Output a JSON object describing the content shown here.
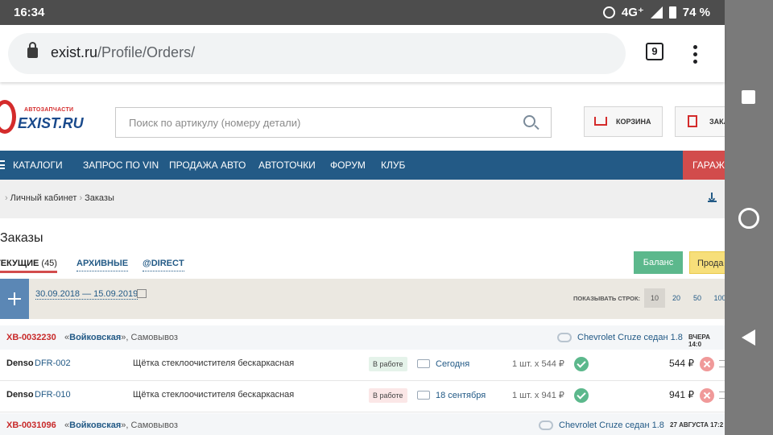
{
  "statusbar": {
    "time": "16:34",
    "network": "4G⁺",
    "battery": "74 %"
  },
  "browser": {
    "url_host": "exist.ru",
    "url_path": "/Profile/Orders/",
    "tab_count": "9"
  },
  "header": {
    "logo_small": "АВТОЗАПЧАСТИ",
    "logo_big": "EXIST.RU",
    "search_placeholder": "Поиск по артикулу (номеру детали)",
    "cart_label": "КОРЗИНА",
    "orders_label": "ЗАКА"
  },
  "menu": {
    "items": [
      "КАТАЛОГИ",
      "ЗАПРОС ПО VIN",
      "ПРОДАЖА АВТО",
      "АВТОТОЧКИ",
      "ФОРУМ",
      "КЛУБ"
    ],
    "garage": "ГАРАЖ"
  },
  "breadcrumbs": {
    "cabinet": "Личный кабинет",
    "current": "Заказы"
  },
  "page": {
    "title": "Заказы"
  },
  "tabs": {
    "current_label": "ТЕКУЩИЕ",
    "current_count": "(45)",
    "archive_label": "АРХИВНЫЕ",
    "direct_label": "@DIRECT"
  },
  "actions": {
    "balance": "Баланс",
    "prod": "Прода"
  },
  "filter": {
    "date_range": "30.09.2018 — 15.09.2019",
    "rows_label": "ПОКАЗЫВАТЬ СТРОК:",
    "rows_options": [
      "10",
      "20",
      "50",
      "100"
    ],
    "rows_selected": "10"
  },
  "orders": [
    {
      "id": "XB-0032230",
      "store": "Войковская",
      "delivery_method": "Самовывоз",
      "car": "Chevrolet Cruze седан 1.8",
      "timestamp": "ВЧЕРА 14:0",
      "items": [
        {
          "brand": "Denso",
          "code": "DFR-002",
          "description": "Щётка стеклоочистителя бескаркасная",
          "status": "В работе",
          "status_color": "#e5f3ea",
          "delivery": "Сегодня",
          "qty": "1 шт. x 544 ₽",
          "total": "544 ₽"
        },
        {
          "brand": "Denso",
          "code": "DFR-010",
          "description": "Щётка стеклоочистителя бескаркасная",
          "status": "В работе",
          "status_color": "#fbe7e7",
          "delivery": "18 сентября",
          "qty": "1 шт. x 941 ₽",
          "total": "941 ₽"
        }
      ]
    },
    {
      "id": "XB-0031096",
      "store": "Войковская",
      "delivery_method": "Самовывоз",
      "car": "Chevrolet Cruze седан 1.8",
      "timestamp": "27 АВГУСТА 17:2",
      "items": []
    }
  ],
  "colors": {
    "menu_bg": "#235a86",
    "accent_red": "#c82a2a",
    "balance_green": "#5cb88c",
    "garage_red": "#d24c4c"
  }
}
